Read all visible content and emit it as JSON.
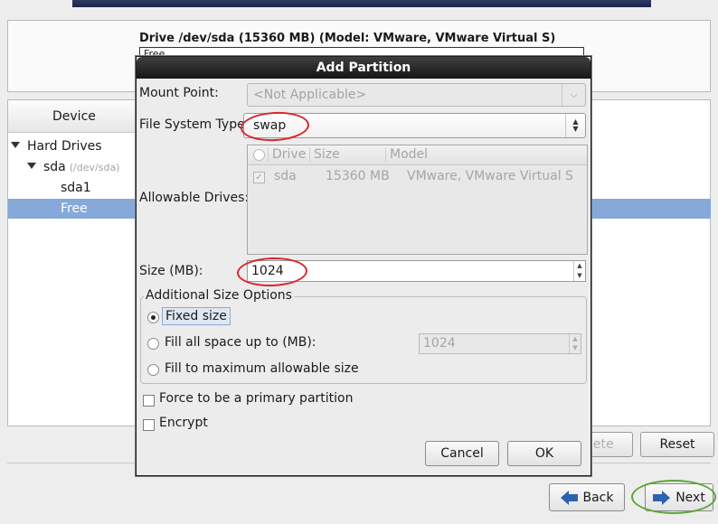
{
  "background": {
    "drive_title": "Drive /dev/sda (15360 MB) (Model: VMware, VMware Virtual S)",
    "drive_bar_label": "Free",
    "tree_header": "Device",
    "tree": {
      "hard_drives": "Hard Drives",
      "sda": "sda",
      "sda_path": "(/dev/sda)",
      "sda1": "sda1",
      "free": "Free"
    },
    "delete_label": "lete",
    "reset_label": "Reset",
    "back_label": "Back",
    "next_label": "Next"
  },
  "dialog": {
    "title": "Add Partition",
    "mount_point_label": "Mount Point:",
    "mount_point_value": "<Not Applicable>",
    "fs_type_label": "File System Type:",
    "fs_type_value": "swap",
    "allowable_drives_label": "Allowable Drives:",
    "drives_columns": [
      "Drive",
      "Size",
      "Model"
    ],
    "drives_rows": [
      {
        "checked": true,
        "drive": "sda",
        "size": "15360 MB",
        "model": "VMware, VMware Virtual S"
      }
    ],
    "size_label": "Size (MB):",
    "size_value": "1024",
    "additional_label": "Additional Size Options",
    "opt_fixed": "Fixed size",
    "opt_fill_upto": "Fill all space up to (MB):",
    "fill_upto_value": "1024",
    "opt_fill_max": "Fill to maximum allowable size",
    "selected_option": "fixed",
    "force_primary": "Force to be a primary partition",
    "encrypt": "Encrypt",
    "cancel_label": "Cancel",
    "ok_label": "OK"
  },
  "annotations": {
    "red_highlight": "#d9262c",
    "green_highlight": "#5ea33a"
  },
  "colors": {
    "selection": "#86a9d9",
    "title_bar": "#161616",
    "arrow": "#2b63b0"
  }
}
